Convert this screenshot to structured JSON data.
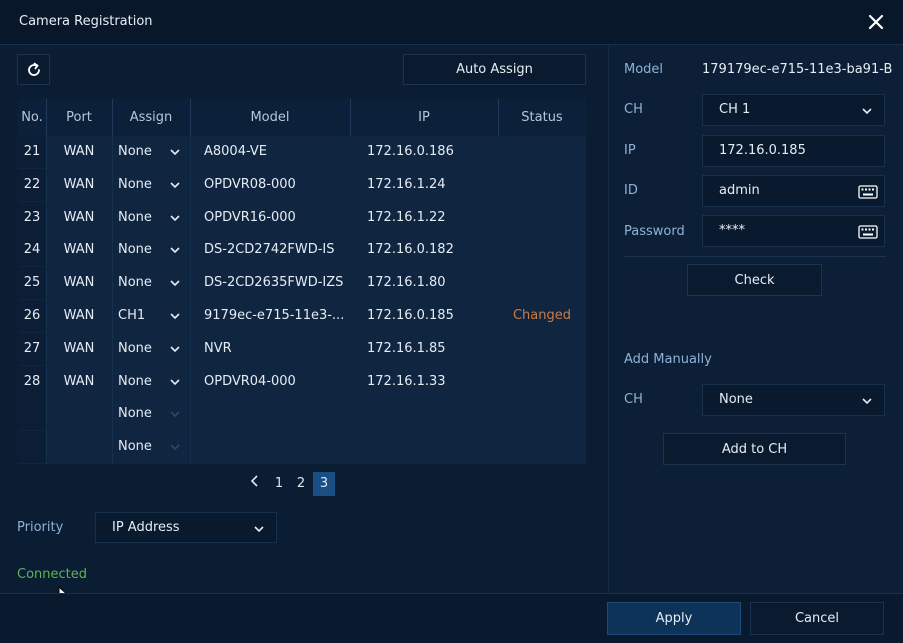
{
  "window": {
    "title": "Camera Registration"
  },
  "toolbar": {
    "auto_assign_label": "Auto Assign"
  },
  "table": {
    "headers": [
      "No.",
      "Port",
      "Assign",
      "Model",
      "IP",
      "Status"
    ],
    "rows": [
      {
        "no": "21",
        "port": "WAN",
        "assign": "None",
        "model": "A8004-VE",
        "ip": "172.16.0.186",
        "status": ""
      },
      {
        "no": "22",
        "port": "WAN",
        "assign": "None",
        "model": "OPDVR08-000",
        "ip": "172.16.1.24",
        "status": ""
      },
      {
        "no": "23",
        "port": "WAN",
        "assign": "None",
        "model": "OPDVR16-000",
        "ip": "172.16.1.22",
        "status": ""
      },
      {
        "no": "24",
        "port": "WAN",
        "assign": "None",
        "model": "DS-2CD2742FWD-IS",
        "ip": "172.16.0.182",
        "status": ""
      },
      {
        "no": "25",
        "port": "WAN",
        "assign": "None",
        "model": "DS-2CD2635FWD-IZS",
        "ip": "172.16.1.80",
        "status": ""
      },
      {
        "no": "26",
        "port": "WAN",
        "assign": "CH1",
        "model": "9179ec-e715-11e3-...",
        "ip": "172.16.0.185",
        "status": "Changed"
      },
      {
        "no": "27",
        "port": "WAN",
        "assign": "None",
        "model": "NVR",
        "ip": "172.16.1.85",
        "status": ""
      },
      {
        "no": "28",
        "port": "WAN",
        "assign": "None",
        "model": "OPDVR04-000",
        "ip": "172.16.1.33",
        "status": ""
      },
      {
        "no": "",
        "port": "",
        "assign": "None",
        "model": "",
        "ip": "",
        "status": ""
      },
      {
        "no": "",
        "port": "",
        "assign": "None",
        "model": "",
        "ip": "",
        "status": ""
      }
    ]
  },
  "pagination": {
    "pages": [
      "1",
      "2",
      "3"
    ],
    "current": "3"
  },
  "priority": {
    "label": "Priority",
    "value": "IP Address"
  },
  "status_text": "Connected",
  "details": {
    "model_label": "Model",
    "model_value": "179179ec-e715-11e3-ba91-B",
    "ch_label": "CH",
    "ch_value": "CH 1",
    "ip_label": "IP",
    "ip_value": "172.16.0.185",
    "id_label": "ID",
    "id_value": "admin",
    "password_label": "Password",
    "password_value": "****",
    "check_label": "Check"
  },
  "manual": {
    "title": "Add Manually",
    "ch_label": "CH",
    "ch_value": "None",
    "add_label": "Add to CH"
  },
  "footer": {
    "apply_label": "Apply",
    "cancel_label": "Cancel"
  },
  "colors": {
    "accent": "#1a4f85",
    "changed": "#c97c45",
    "connected": "#5fb15a",
    "label": "#8fb2d6"
  }
}
